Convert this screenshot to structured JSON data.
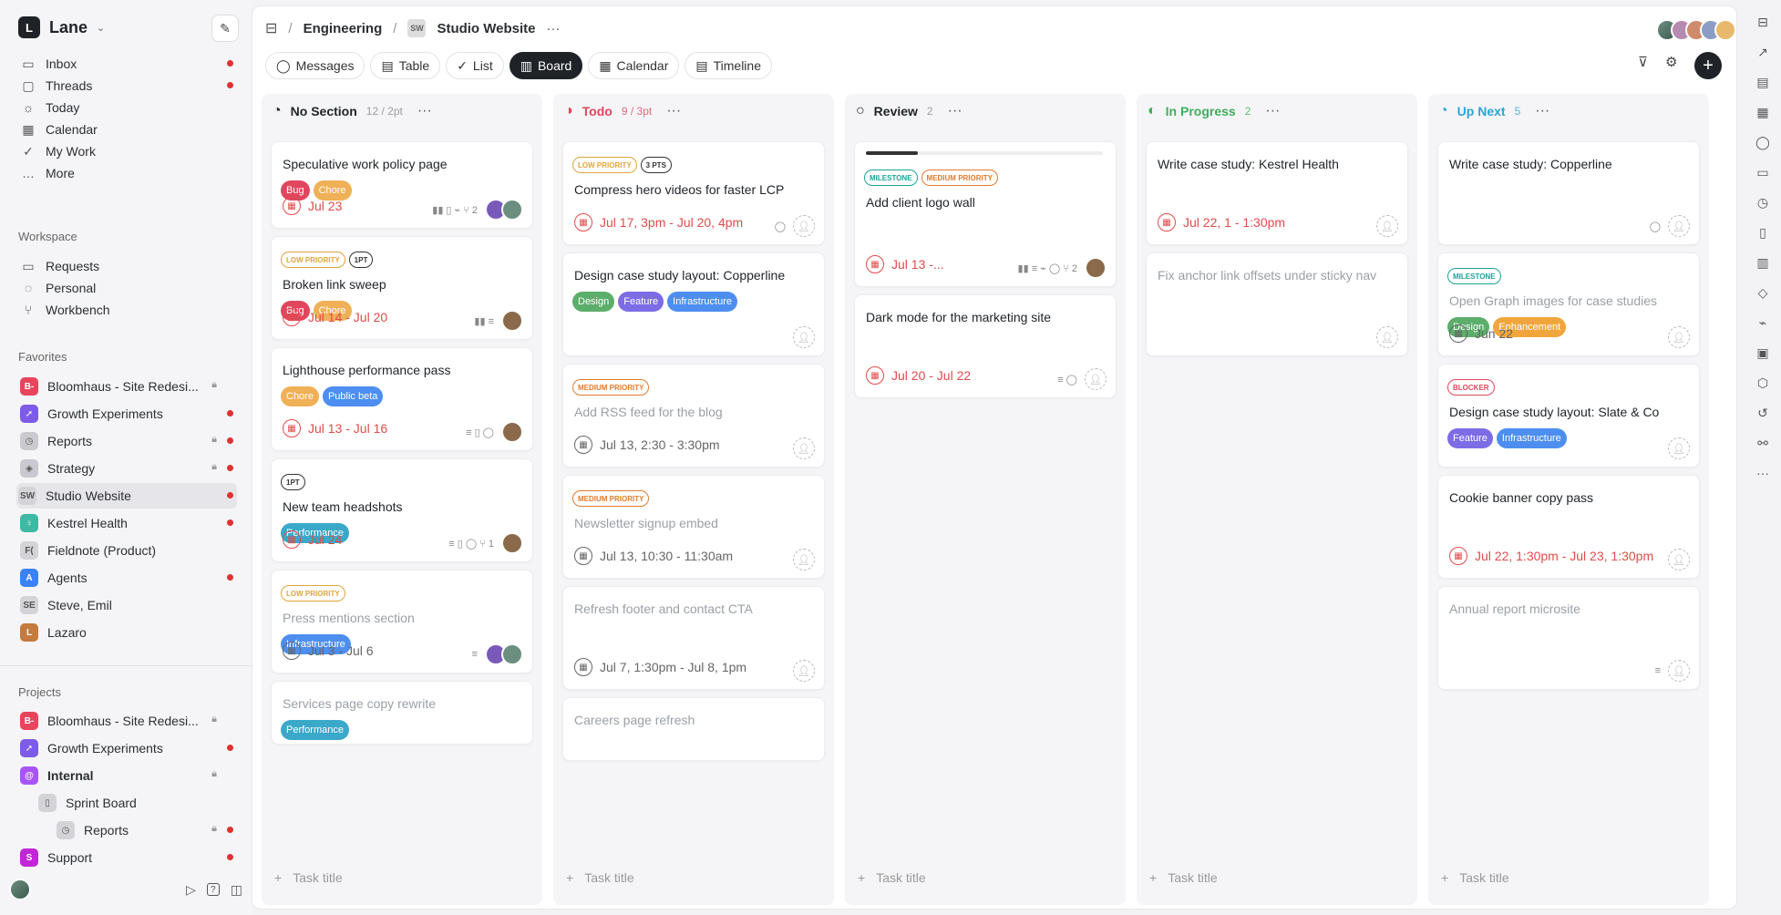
{
  "workspace": {
    "logo": "L",
    "name": "Lane"
  },
  "nav": [
    {
      "label": "Inbox",
      "icon": "inbox-icon",
      "glyph": "▭",
      "dot": true
    },
    {
      "label": "Threads",
      "icon": "threads-icon",
      "glyph": "▢",
      "dot": true
    },
    {
      "label": "Today",
      "icon": "sun-icon",
      "glyph": "☼",
      "dot": false
    },
    {
      "label": "Calendar",
      "icon": "calendar-icon",
      "glyph": "▦",
      "dot": false
    },
    {
      "label": "My Work",
      "icon": "check-circle-icon",
      "glyph": "✓",
      "dot": false
    },
    {
      "label": "More",
      "icon": "more-icon",
      "glyph": "…",
      "dot": false
    }
  ],
  "workspace_section": {
    "label": "Workspace",
    "items": [
      {
        "label": "Requests",
        "icon": "inbox-icon",
        "glyph": "▭"
      },
      {
        "label": "Personal",
        "icon": "circle-dashed-icon",
        "glyph": "◌"
      },
      {
        "label": "Workbench",
        "icon": "tree-icon",
        "glyph": "⑂"
      }
    ]
  },
  "favorites": {
    "label": "Favorites",
    "items": [
      {
        "label": "Bloomhaus - Site Redesi...",
        "abbr": "B-",
        "color": "#e8455d",
        "lock": true,
        "dot": false,
        "active": false
      },
      {
        "label": "Growth Experiments",
        "abbr": "➚",
        "color": "#7c5ce6",
        "lock": false,
        "dot": true,
        "active": false
      },
      {
        "label": "Reports",
        "abbr": "◷",
        "color": "#c9c9cf",
        "lock": true,
        "dot": true,
        "active": false
      },
      {
        "label": "Strategy",
        "abbr": "◈",
        "color": "#c9c9cf",
        "lock": true,
        "dot": true,
        "active": false
      },
      {
        "label": "Studio Website",
        "abbr": "SW",
        "color": "#d4d4d8",
        "lock": false,
        "dot": true,
        "active": true
      },
      {
        "label": "Kestrel Health",
        "abbr": "♀",
        "color": "#3fb8a4",
        "lock": false,
        "dot": true,
        "active": false
      },
      {
        "label": "Fieldnote (Product)",
        "abbr": "F(",
        "color": "#d4d4d8",
        "lock": false,
        "dot": false,
        "active": false
      },
      {
        "label": "Agents",
        "abbr": "A",
        "color": "#3b82f6",
        "lock": false,
        "dot": true,
        "active": false
      },
      {
        "label": "Steve, Emil",
        "abbr": "SE",
        "color": "#d4d4d8",
        "lock": false,
        "dot": false,
        "active": false
      },
      {
        "label": "Lazaro",
        "abbr": "L",
        "color": "#c57a3e",
        "lock": false,
        "dot": false,
        "active": false
      }
    ]
  },
  "projects": {
    "label": "Projects",
    "items": [
      {
        "label": "Bloomhaus - Site Redesi...",
        "abbr": "B-",
        "color": "#e8455d",
        "lock": true,
        "dot": false,
        "bold": false,
        "indent": 0
      },
      {
        "label": "Growth Experiments",
        "abbr": "➚",
        "color": "#7c5ce6",
        "lock": false,
        "dot": true,
        "bold": false,
        "indent": 0
      },
      {
        "label": "Internal",
        "abbr": "@",
        "color": "#a855f7",
        "lock": true,
        "dot": false,
        "bold": true,
        "indent": 0
      },
      {
        "label": "Sprint Board",
        "abbr": "▯",
        "color": "#d4d4d8",
        "lock": false,
        "dot": false,
        "bold": false,
        "indent": 1
      },
      {
        "label": "Reports",
        "abbr": "◷",
        "color": "#d4d4d8",
        "lock": true,
        "dot": true,
        "bold": false,
        "indent": 2
      },
      {
        "label": "Support",
        "abbr": "S",
        "color": "#c026d3",
        "lock": false,
        "dot": true,
        "bold": false,
        "indent": 0
      }
    ]
  },
  "breadcrumb": {
    "section": "Engineering",
    "project_abbr": "SW",
    "project": "Studio Website",
    "more": "···"
  },
  "tabs": [
    {
      "label": "Messages",
      "icon": "chat-icon",
      "glyph": "◯",
      "selected": false
    },
    {
      "label": "Table",
      "icon": "table-icon",
      "glyph": "▤",
      "selected": false
    },
    {
      "label": "List",
      "icon": "list-check-icon",
      "glyph": "✓",
      "selected": false
    },
    {
      "label": "Board",
      "icon": "board-icon",
      "glyph": "▥",
      "selected": true
    },
    {
      "label": "Calendar",
      "icon": "calendar-icon",
      "glyph": "▦",
      "selected": false
    },
    {
      "label": "Timeline",
      "icon": "timeline-icon",
      "glyph": "▤",
      "selected": false
    }
  ],
  "add_task_placeholder": "Task title",
  "columns": [
    {
      "title": "No Section",
      "count": "12 / 2pt",
      "color": "#1f2328",
      "status_icon": "status-empty-icon",
      "cards": [
        {
          "title": "Speculative work policy page",
          "muted": false,
          "pills": [],
          "tags": [
            {
              "label": "Bug",
              "color": "#e0475e"
            },
            {
              "label": "Chore",
              "color": "#f0b057"
            }
          ],
          "date": "Jul 23",
          "date_color": "#e14b4b",
          "meta": "▮▮ ▯ ⌁ ⑂ 2",
          "assignee": "pair",
          "height": 96
        },
        {
          "title": "Broken link sweep",
          "muted": false,
          "pills": [
            {
              "label": "LOW PRIORITY",
              "color": "#e0a43c"
            },
            {
              "label": "1PT",
              "color": "#333"
            }
          ],
          "tags": [
            {
              "label": "Bug",
              "color": "#e0475e"
            },
            {
              "label": "Chore",
              "color": "#f0b057"
            }
          ],
          "date": "Jul 14 - Jul 20",
          "date_color": "#e14b4b",
          "meta": "▮▮ ≡",
          "assignee": "person",
          "height": 114
        },
        {
          "title": "Lighthouse performance pass",
          "muted": false,
          "pills": [],
          "tags": [
            {
              "label": "Chore",
              "color": "#f0b057"
            },
            {
              "label": "Public beta",
              "color": "#4d8ef0"
            }
          ],
          "date": "Jul 13 - Jul 16",
          "date_color": "#e14b4b",
          "meta": "≡ ▯ ◯",
          "assignee": "person",
          "height": 114
        },
        {
          "title": "New team headshots",
          "muted": false,
          "pills": [
            {
              "label": "1PT",
              "color": "#333"
            }
          ],
          "tags": [
            {
              "label": "Performance",
              "color": "#3aa9c9"
            }
          ],
          "date": "Jul 24",
          "date_color": "#e14b4b",
          "meta": "≡ ▯ ◯ ⑂ 1",
          "assignee": "person",
          "height": 114
        },
        {
          "title": "Press mentions section",
          "muted": true,
          "pills": [
            {
              "label": "LOW PRIORITY",
              "color": "#e0a43c"
            }
          ],
          "tags": [
            {
              "label": "Infrastructure",
              "color": "#4d8ef0"
            }
          ],
          "date": "Jul 3 - Jul 6",
          "date_color": "#666",
          "meta": "≡",
          "assignee": "pair",
          "height": 114
        },
        {
          "title": "Services page copy rewrite",
          "muted": true,
          "pills": [],
          "tags": [
            {
              "label": "Performance",
              "color": "#3aa9c9"
            }
          ],
          "date": "",
          "date_color": "#666",
          "meta": "",
          "assignee": "",
          "height": 70
        }
      ]
    },
    {
      "title": "Todo",
      "count": "9 / 3pt",
      "color": "#e0475e",
      "status_icon": "status-todo-icon",
      "cards": [
        {
          "title": "Compress hero videos for faster LCP",
          "muted": false,
          "pills": [
            {
              "label": "LOW PRIORITY",
              "color": "#e0a43c"
            },
            {
              "label": "3 PTS",
              "color": "#333"
            }
          ],
          "tags": [],
          "date": "Jul 17, 3pm - Jul 20, 4pm",
          "date_color": "#e14b4b",
          "meta": "◯",
          "assignee": "empty",
          "height": 114
        },
        {
          "title": "Design case study layout: Copperline",
          "muted": false,
          "pills": [],
          "tags": [
            {
              "label": "Design",
              "color": "#5cae6b"
            },
            {
              "label": "Feature",
              "color": "#7c6ce6"
            },
            {
              "label": "Infrastructure",
              "color": "#4d8ef0"
            }
          ],
          "date": "",
          "date_color": "#666",
          "meta": "",
          "assignee": "empty",
          "height": 114
        },
        {
          "title": "Add RSS feed for the blog",
          "muted": true,
          "pills": [
            {
              "label": "MEDIUM PRIORITY",
              "color": "#e07b2c"
            }
          ],
          "tags": [],
          "date": "Jul 13, 2:30 - 3:30pm",
          "date_color": "#666",
          "meta": "",
          "assignee": "empty",
          "height": 114
        },
        {
          "title": "Newsletter signup embed",
          "muted": true,
          "pills": [
            {
              "label": "MEDIUM PRIORITY",
              "color": "#e07b2c"
            }
          ],
          "tags": [],
          "date": "Jul 13, 10:30 - 11:30am",
          "date_color": "#666",
          "meta": "",
          "assignee": "empty",
          "height": 114
        },
        {
          "title": "Refresh footer and contact CTA",
          "muted": true,
          "pills": [],
          "tags": [],
          "date": "Jul 7, 1:30pm - Jul 8, 1pm",
          "date_color": "#666",
          "meta": "",
          "assignee": "empty",
          "height": 114
        },
        {
          "title": "Careers page refresh",
          "muted": true,
          "pills": [],
          "tags": [],
          "date": "",
          "date_color": "#666",
          "meta": "",
          "assignee": "",
          "height": 70
        }
      ]
    },
    {
      "title": "Review",
      "count": "2",
      "color": "#1f2328",
      "status_icon": "status-review-icon",
      "cards": [
        {
          "title": "Add client logo wall",
          "muted": false,
          "progress": 0.22,
          "pills": [
            {
              "label": "MILESTONE",
              "color": "#1ba39c"
            },
            {
              "label": "MEDIUM PRIORITY",
              "color": "#e07b2c"
            }
          ],
          "tags": [],
          "date": "Jul 13 -...",
          "date_color": "#e14b4b",
          "meta": "▮▮ ≡ ⌁ ◯ ⑂ 2",
          "assignee": "person",
          "height": 160
        },
        {
          "title": "Dark mode for the marketing site",
          "muted": false,
          "pills": [],
          "tags": [],
          "date": "Jul 20 - Jul 22",
          "date_color": "#e14b4b",
          "meta": "≡ ◯",
          "assignee": "empty",
          "height": 114
        }
      ]
    },
    {
      "title": "In Progress",
      "count": "2",
      "color": "#3fae5a",
      "status_icon": "status-progress-icon",
      "cards": [
        {
          "title": "Write case study: Kestrel Health",
          "muted": false,
          "pills": [],
          "tags": [],
          "date": "Jul 22, 1 - 1:30pm",
          "date_color": "#e14b4b",
          "meta": "",
          "assignee": "empty",
          "height": 114
        },
        {
          "title": "Fix anchor link offsets under sticky nav",
          "muted": true,
          "pills": [],
          "tags": [],
          "date": "",
          "date_color": "#666",
          "meta": "",
          "assignee": "empty",
          "height": 114
        }
      ]
    },
    {
      "title": "Up Next",
      "count": "5",
      "color": "#2ba3d6",
      "status_icon": "status-upnext-icon",
      "cards": [
        {
          "title": "Write case study: Copperline",
          "muted": false,
          "pills": [],
          "tags": [],
          "date": "",
          "date_color": "#666",
          "meta": "◯",
          "assignee": "empty",
          "height": 114
        },
        {
          "title": "Open Graph images for case studies",
          "muted": true,
          "pills": [
            {
              "label": "MILESTONE",
              "color": "#1ba39c"
            }
          ],
          "tags": [
            {
              "label": "Design",
              "color": "#5cae6b"
            },
            {
              "label": "Enhancement",
              "color": "#f0a63c"
            }
          ],
          "date": "Jun 22",
          "date_color": "#666",
          "meta": "",
          "assignee": "empty",
          "height": 114
        },
        {
          "title": "Design case study layout: Slate & Co",
          "muted": false,
          "pills": [
            {
              "label": "BLOCKER",
              "color": "#e0475e"
            }
          ],
          "tags": [
            {
              "label": "Feature",
              "color": "#7c6ce6"
            },
            {
              "label": "Infrastructure",
              "color": "#4d8ef0"
            }
          ],
          "date": "",
          "date_color": "#666",
          "meta": "",
          "assignee": "empty",
          "height": 114
        },
        {
          "title": "Cookie banner copy pass",
          "muted": false,
          "pills": [],
          "tags": [],
          "date": "Jul 22, 1:30pm - Jul 23, 1:30pm",
          "date_color": "#e14b4b",
          "meta": "",
          "assignee": "empty",
          "height": 114
        },
        {
          "title": "Annual report microsite",
          "muted": true,
          "pills": [],
          "tags": [],
          "date": "",
          "date_color": "#666",
          "meta": "≡",
          "assignee": "empty",
          "height": 114
        }
      ]
    }
  ],
  "rail_icons": [
    "inbox-icon",
    "chart-icon",
    "clipboard-icon",
    "calendar-icon",
    "chat-icon",
    "note-icon",
    "timer-icon",
    "bookmark-icon",
    "map-icon",
    "shapes-icon",
    "paperclip-icon",
    "wallet-icon",
    "cube-icon",
    "history-icon",
    "webhook-icon",
    "more-icon"
  ]
}
